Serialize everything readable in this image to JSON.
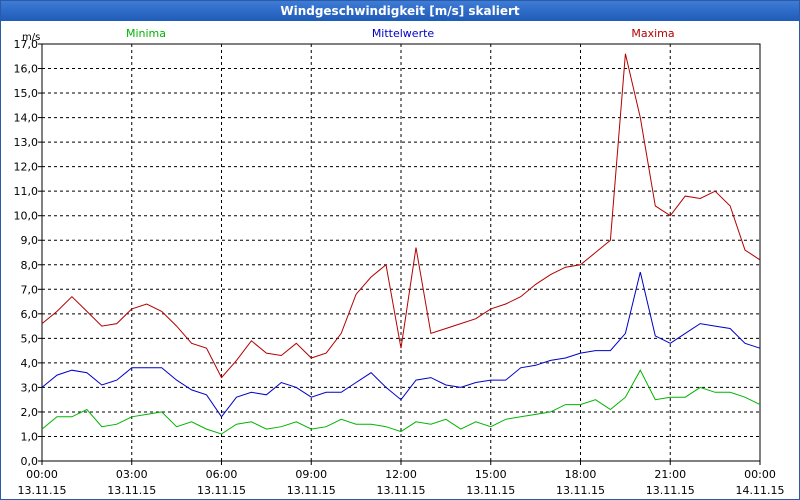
{
  "window": {
    "title": "Windgeschwindigkeit [m/s] skaliert"
  },
  "chart_data": {
    "type": "line",
    "title": "Windgeschwindigkeit [m/s] skaliert",
    "ylabel": "m/s",
    "xlabel": "",
    "ylim": [
      0,
      17
    ],
    "xlim_hours": [
      0,
      24
    ],
    "grid": true,
    "legend_placement": "top",
    "y_ticks": [
      "0,0",
      "1,0",
      "2,0",
      "3,0",
      "4,0",
      "5,0",
      "6,0",
      "7,0",
      "8,0",
      "9,0",
      "10,0",
      "11,0",
      "12,0",
      "13,0",
      "14,0",
      "15,0",
      "16,0",
      "17,0"
    ],
    "x_ticks": [
      {
        "time": "00:00",
        "date": "13.11.15"
      },
      {
        "time": "03:00",
        "date": "13.11.15"
      },
      {
        "time": "06:00",
        "date": "13.11.15"
      },
      {
        "time": "09:00",
        "date": "13.11.15"
      },
      {
        "time": "12:00",
        "date": "13.11.15"
      },
      {
        "time": "15:00",
        "date": "13.11.15"
      },
      {
        "time": "18:00",
        "date": "13.11.15"
      },
      {
        "time": "21:00",
        "date": "13.11.15"
      },
      {
        "time": "00:00",
        "date": "14.11.15"
      }
    ],
    "series": [
      {
        "name": "Minima",
        "color": "#00b400",
        "x": [
          0,
          0.5,
          1,
          1.5,
          2,
          2.5,
          3,
          3.5,
          4,
          4.5,
          5,
          5.5,
          6,
          6.5,
          7,
          7.5,
          8,
          8.5,
          9,
          9.5,
          10,
          10.5,
          11,
          11.5,
          12,
          12.5,
          13,
          13.5,
          14,
          14.5,
          15,
          15.5,
          16,
          16.5,
          17,
          17.5,
          18,
          18.5,
          19,
          19.5,
          20,
          20.5,
          21,
          21.5,
          22,
          22.5,
          23,
          23.5,
          24
        ],
        "values": [
          1.3,
          1.8,
          1.8,
          2.1,
          1.4,
          1.5,
          1.8,
          1.9,
          2.0,
          1.4,
          1.6,
          1.3,
          1.1,
          1.5,
          1.6,
          1.3,
          1.4,
          1.6,
          1.3,
          1.4,
          1.7,
          1.5,
          1.5,
          1.4,
          1.2,
          1.6,
          1.5,
          1.7,
          1.3,
          1.6,
          1.4,
          1.7,
          1.8,
          1.9,
          2.0,
          2.3,
          2.3,
          2.5,
          2.1,
          2.6,
          3.7,
          2.5,
          2.6,
          2.6,
          3.0,
          2.8,
          2.8,
          2.6,
          2.3
        ]
      },
      {
        "name": "Mittelwerte",
        "color": "#0000c8",
        "x": [
          0,
          0.5,
          1,
          1.5,
          2,
          2.5,
          3,
          3.5,
          4,
          4.5,
          5,
          5.5,
          6,
          6.5,
          7,
          7.5,
          8,
          8.5,
          9,
          9.5,
          10,
          10.5,
          11,
          11.5,
          12,
          12.5,
          13,
          13.5,
          14,
          14.5,
          15,
          15.5,
          16,
          16.5,
          17,
          17.5,
          18,
          18.5,
          19,
          19.5,
          20,
          20.5,
          21,
          21.5,
          22,
          22.5,
          23,
          23.5,
          24
        ],
        "values": [
          3.0,
          3.5,
          3.7,
          3.6,
          3.1,
          3.3,
          3.8,
          3.8,
          3.8,
          3.3,
          2.9,
          2.7,
          1.8,
          2.6,
          2.8,
          2.7,
          3.2,
          3.0,
          2.6,
          2.8,
          2.8,
          3.2,
          3.6,
          3.0,
          2.5,
          3.3,
          3.4,
          3.1,
          3.0,
          3.2,
          3.3,
          3.3,
          3.8,
          3.9,
          4.1,
          4.2,
          4.4,
          4.5,
          4.5,
          5.2,
          7.7,
          5.1,
          4.8,
          5.2,
          5.6,
          5.5,
          5.4,
          4.8,
          4.6
        ]
      },
      {
        "name": "Maxima",
        "color": "#b40000",
        "x": [
          0,
          0.5,
          1,
          1.5,
          2,
          2.5,
          3,
          3.5,
          4,
          4.5,
          5,
          5.5,
          6,
          6.5,
          7,
          7.5,
          8,
          8.5,
          9,
          9.5,
          10,
          10.5,
          11,
          11.5,
          12,
          12.5,
          13,
          13.5,
          14,
          14.5,
          15,
          15.5,
          16,
          16.5,
          17,
          17.5,
          18,
          18.5,
          19,
          19.5,
          20,
          20.5,
          21,
          21.5,
          22,
          22.5,
          23,
          23.5,
          24
        ],
        "values": [
          5.6,
          6.1,
          6.7,
          6.1,
          5.5,
          5.6,
          6.2,
          6.4,
          6.1,
          5.5,
          4.8,
          4.6,
          3.4,
          4.1,
          4.9,
          4.4,
          4.3,
          4.8,
          4.2,
          4.4,
          5.2,
          6.8,
          7.5,
          8.0,
          4.6,
          8.7,
          5.2,
          5.4,
          5.6,
          5.8,
          6.2,
          6.4,
          6.7,
          7.2,
          7.6,
          7.9,
          8.0,
          8.5,
          9.0,
          16.6,
          14.0,
          10.4,
          10.0,
          10.8,
          10.7,
          11.0,
          10.4,
          8.6,
          8.2
        ]
      }
    ]
  }
}
